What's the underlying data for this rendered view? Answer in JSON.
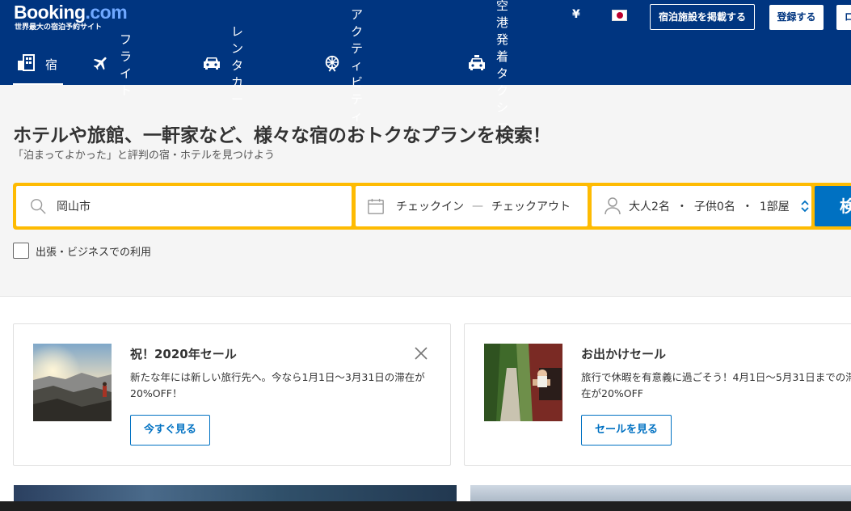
{
  "header": {
    "logo_main": "Booking",
    "logo_dot": ".com",
    "logo_sub": "世界最大の宿泊予約サイト",
    "currency": "¥",
    "list_property_label": "宿泊施設を掲載する",
    "register_label": "登録する",
    "login_label": "ロ",
    "nav": [
      {
        "label": "宿",
        "icon": "bed-icon"
      },
      {
        "label": "フライト",
        "icon": "plane-icon"
      },
      {
        "label": "レンタカー",
        "icon": "car-icon"
      },
      {
        "label": "アクティビティ",
        "icon": "ferris-wheel-icon"
      },
      {
        "label": "空港発着タクシー",
        "icon": "taxi-icon"
      }
    ],
    "colors": {
      "brand": "#003580",
      "accent": "#febb02",
      "button": "#0071c2"
    }
  },
  "hero": {
    "title": "ホテルや旅館、一軒家など、様々な宿のおトクなプランを検索！",
    "subtitle": "「泊まってよかった」と評判の宿・ホテルを見つけよう"
  },
  "search": {
    "destination_value": "岡山市",
    "checkin_label": "チェックイン",
    "date_separator": "—",
    "checkout_label": "チェックアウト",
    "adults": "大人2名",
    "children": "子供0名",
    "rooms": "1部屋",
    "guest_separator": "・",
    "search_button_label": "検索",
    "business_trip_label": "出張・ビジネスでの利用"
  },
  "cards": [
    {
      "title": "祝！2020年セール",
      "description": "新たな年には新しい旅行先へ。今なら1月1日〜3月31日の滞在が20%OFF！",
      "button_label": "今すぐ見る"
    },
    {
      "title": "お出かけセール",
      "description": "旅行で休暇を有意義に過ごそう！4月1日〜5月31日までの滞在が20%OFF",
      "button_label": "セールを見る"
    }
  ]
}
